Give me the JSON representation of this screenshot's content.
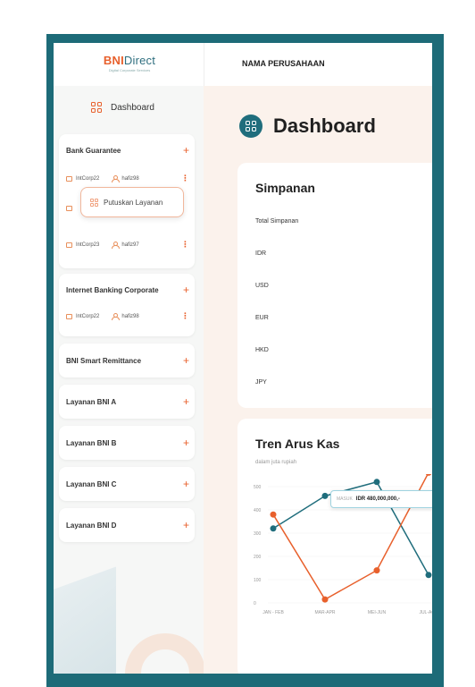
{
  "app": {
    "logo_text_main": "BNI",
    "logo_text_accent": "Direct",
    "logo_subtitle": "Digital Corporate Services",
    "company_name": "NAMA PERUSAHAAN"
  },
  "sidebar": {
    "dashboard_label": "Dashboard",
    "cards": [
      {
        "title": "Bank Guarantee",
        "accounts": [
          {
            "corp": "IntCorp22",
            "user": "hafiz98"
          },
          {
            "corp": "",
            "user": ""
          },
          {
            "corp": "IntCorp23",
            "user": "hafiz97"
          }
        ]
      },
      {
        "title": "Internet Banking Corporate",
        "accounts": [
          {
            "corp": "IntCorp22",
            "user": "hafiz98"
          }
        ]
      },
      {
        "title": "BNI Smart Remittance"
      },
      {
        "title": "Layanan BNI A"
      },
      {
        "title": "Layanan BNI B"
      },
      {
        "title": "Layanan BNI C"
      },
      {
        "title": "Layanan BNI D"
      }
    ],
    "popup_label": "Putuskan Layanan"
  },
  "main": {
    "page_title": "Dashboard",
    "simpanan": {
      "title": "Simpanan",
      "rows": [
        "Total Simpanan",
        "IDR",
        "USD",
        "EUR",
        "HKD",
        "JPY"
      ]
    },
    "tren": {
      "title": "Tren Arus Kas",
      "subtitle": "dalam juta rupiah",
      "tooltip_key": "MASUK",
      "tooltip_value": "IDR 480,000,000,-"
    }
  },
  "colors": {
    "accent": "#e8602c",
    "primary": "#1f6d7c",
    "frame": "#1d6b78",
    "main_bg": "#fbf2ec"
  },
  "chart_data": {
    "type": "line",
    "title": "Tren Arus Kas",
    "subtitle": "dalam juta rupiah",
    "categories": [
      "JAN - FEB",
      "MAR-APR",
      "MEI-JUN",
      "JUL-AGS"
    ],
    "y_ticks": [
      "0",
      "100",
      "200",
      "300",
      "400",
      "500"
    ],
    "ylim": [
      0,
      500
    ],
    "series": [
      {
        "color": "#1f6d7c",
        "values": [
          320,
          460,
          520,
          120
        ]
      },
      {
        "color": "#e8602c",
        "values": [
          380,
          15,
          140,
          560
        ]
      }
    ],
    "grid": true
  }
}
